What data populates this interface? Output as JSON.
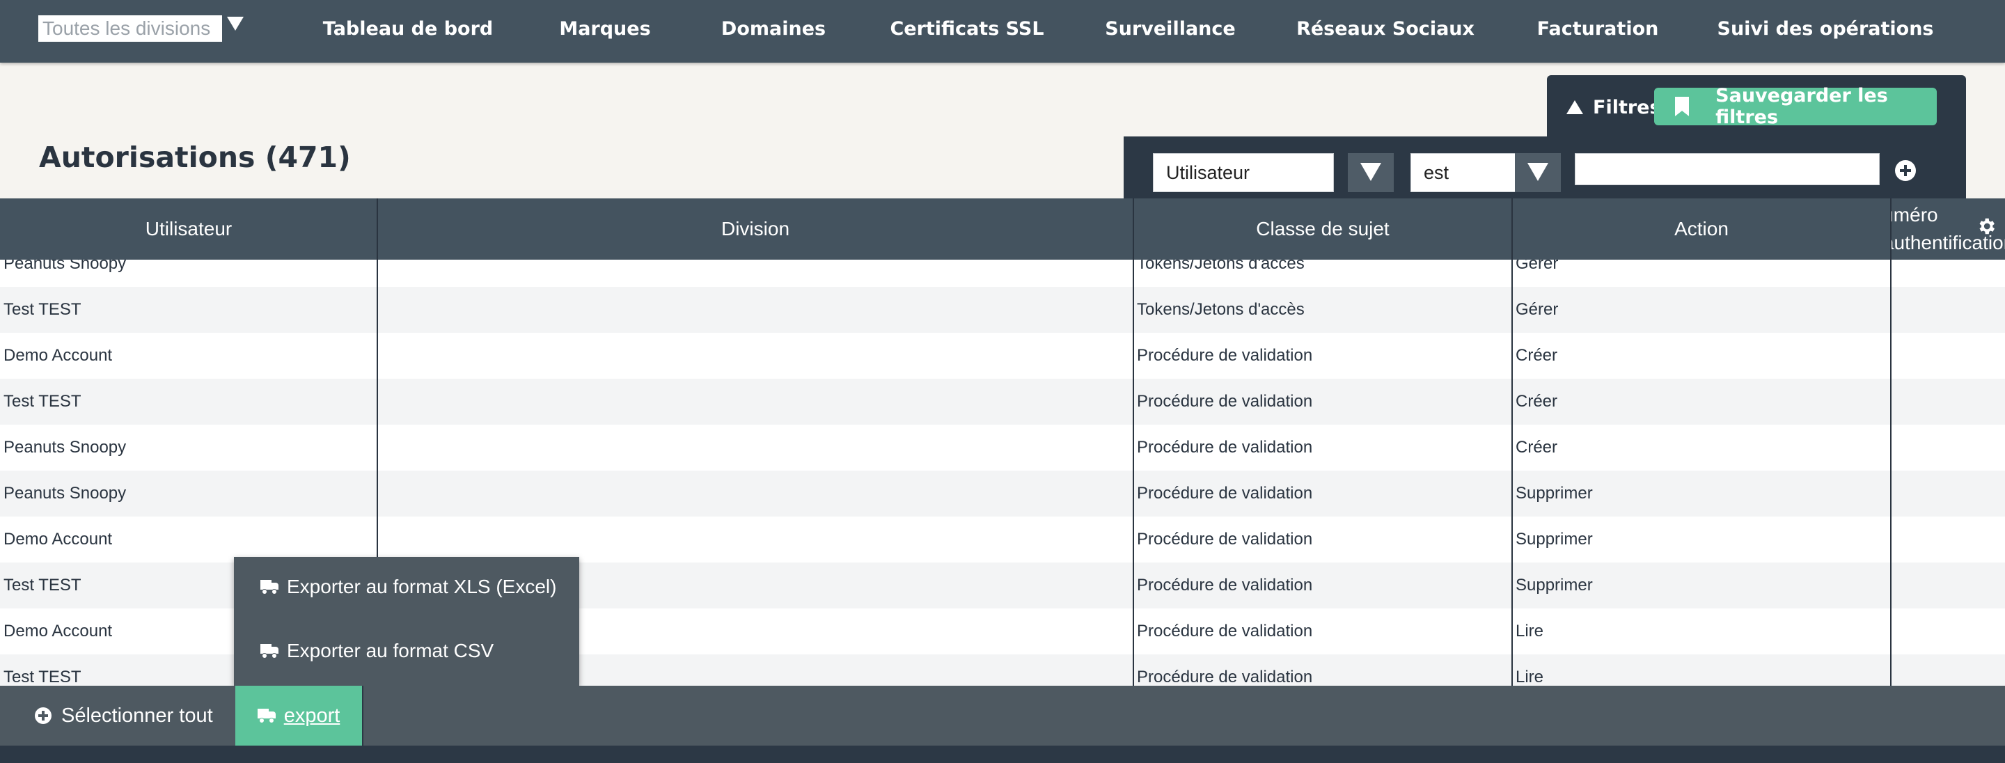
{
  "nav": {
    "division_select": "Toutes les divisions",
    "items": [
      "Tableau de bord",
      "Marques",
      "Domaines",
      "Certificats SSL",
      "Surveillance",
      "Réseaux Sociaux",
      "Facturation",
      "Suivi des opérations"
    ]
  },
  "filters": {
    "toggle_label": "Filtres",
    "save_label": "Sauvegarder les filtres",
    "field_value": "Utilisateur",
    "operator_value": "est",
    "text_value": ""
  },
  "page": {
    "title": "Autorisations",
    "count": "(471)"
  },
  "table": {
    "headers": [
      "Utilisateur",
      "Division",
      "Classe de sujet",
      "Action"
    ],
    "partial_header_line1": "Numéro",
    "partial_header_line2": "d'authentification",
    "rows": [
      {
        "user": "Peanuts Snoopy",
        "division": "",
        "subject": "Tokens/Jetons d'accès",
        "action": "Gérer"
      },
      {
        "user": "Test TEST",
        "division": "",
        "subject": "Tokens/Jetons d'accès",
        "action": "Gérer"
      },
      {
        "user": "Demo Account",
        "division": "",
        "subject": "Procédure de validation",
        "action": "Créer"
      },
      {
        "user": "Test TEST",
        "division": "",
        "subject": "Procédure de validation",
        "action": "Créer"
      },
      {
        "user": "Peanuts Snoopy",
        "division": "",
        "subject": "Procédure de validation",
        "action": "Créer"
      },
      {
        "user": "Peanuts Snoopy",
        "division": "",
        "subject": "Procédure de validation",
        "action": "Supprimer"
      },
      {
        "user": "Demo Account",
        "division": "",
        "subject": "Procédure de validation",
        "action": "Supprimer"
      },
      {
        "user": "Test TEST",
        "division": "",
        "subject": "Procédure de validation",
        "action": "Supprimer"
      },
      {
        "user": "Demo Account",
        "division": "",
        "subject": "Procédure de validation",
        "action": "Lire"
      },
      {
        "user": "Test TEST",
        "division": "",
        "subject": "Procédure de validation",
        "action": "Lire"
      }
    ]
  },
  "export_menu": {
    "xls_label": "Exporter au format XLS (Excel)",
    "csv_label": "Exporter au format CSV"
  },
  "footer": {
    "select_all_label": "Sélectionner tout",
    "export_label": "export"
  },
  "colors": {
    "nav_bg": "#44535f",
    "accent_green": "#5cc49b",
    "dark_panel": "#2c3845",
    "row_alt": "#f3f4f5"
  },
  "icons": [
    "chevron-down-icon",
    "triangle-up-icon",
    "bookmark-icon",
    "plus-circle-icon",
    "gear-icon",
    "truck-icon"
  ]
}
